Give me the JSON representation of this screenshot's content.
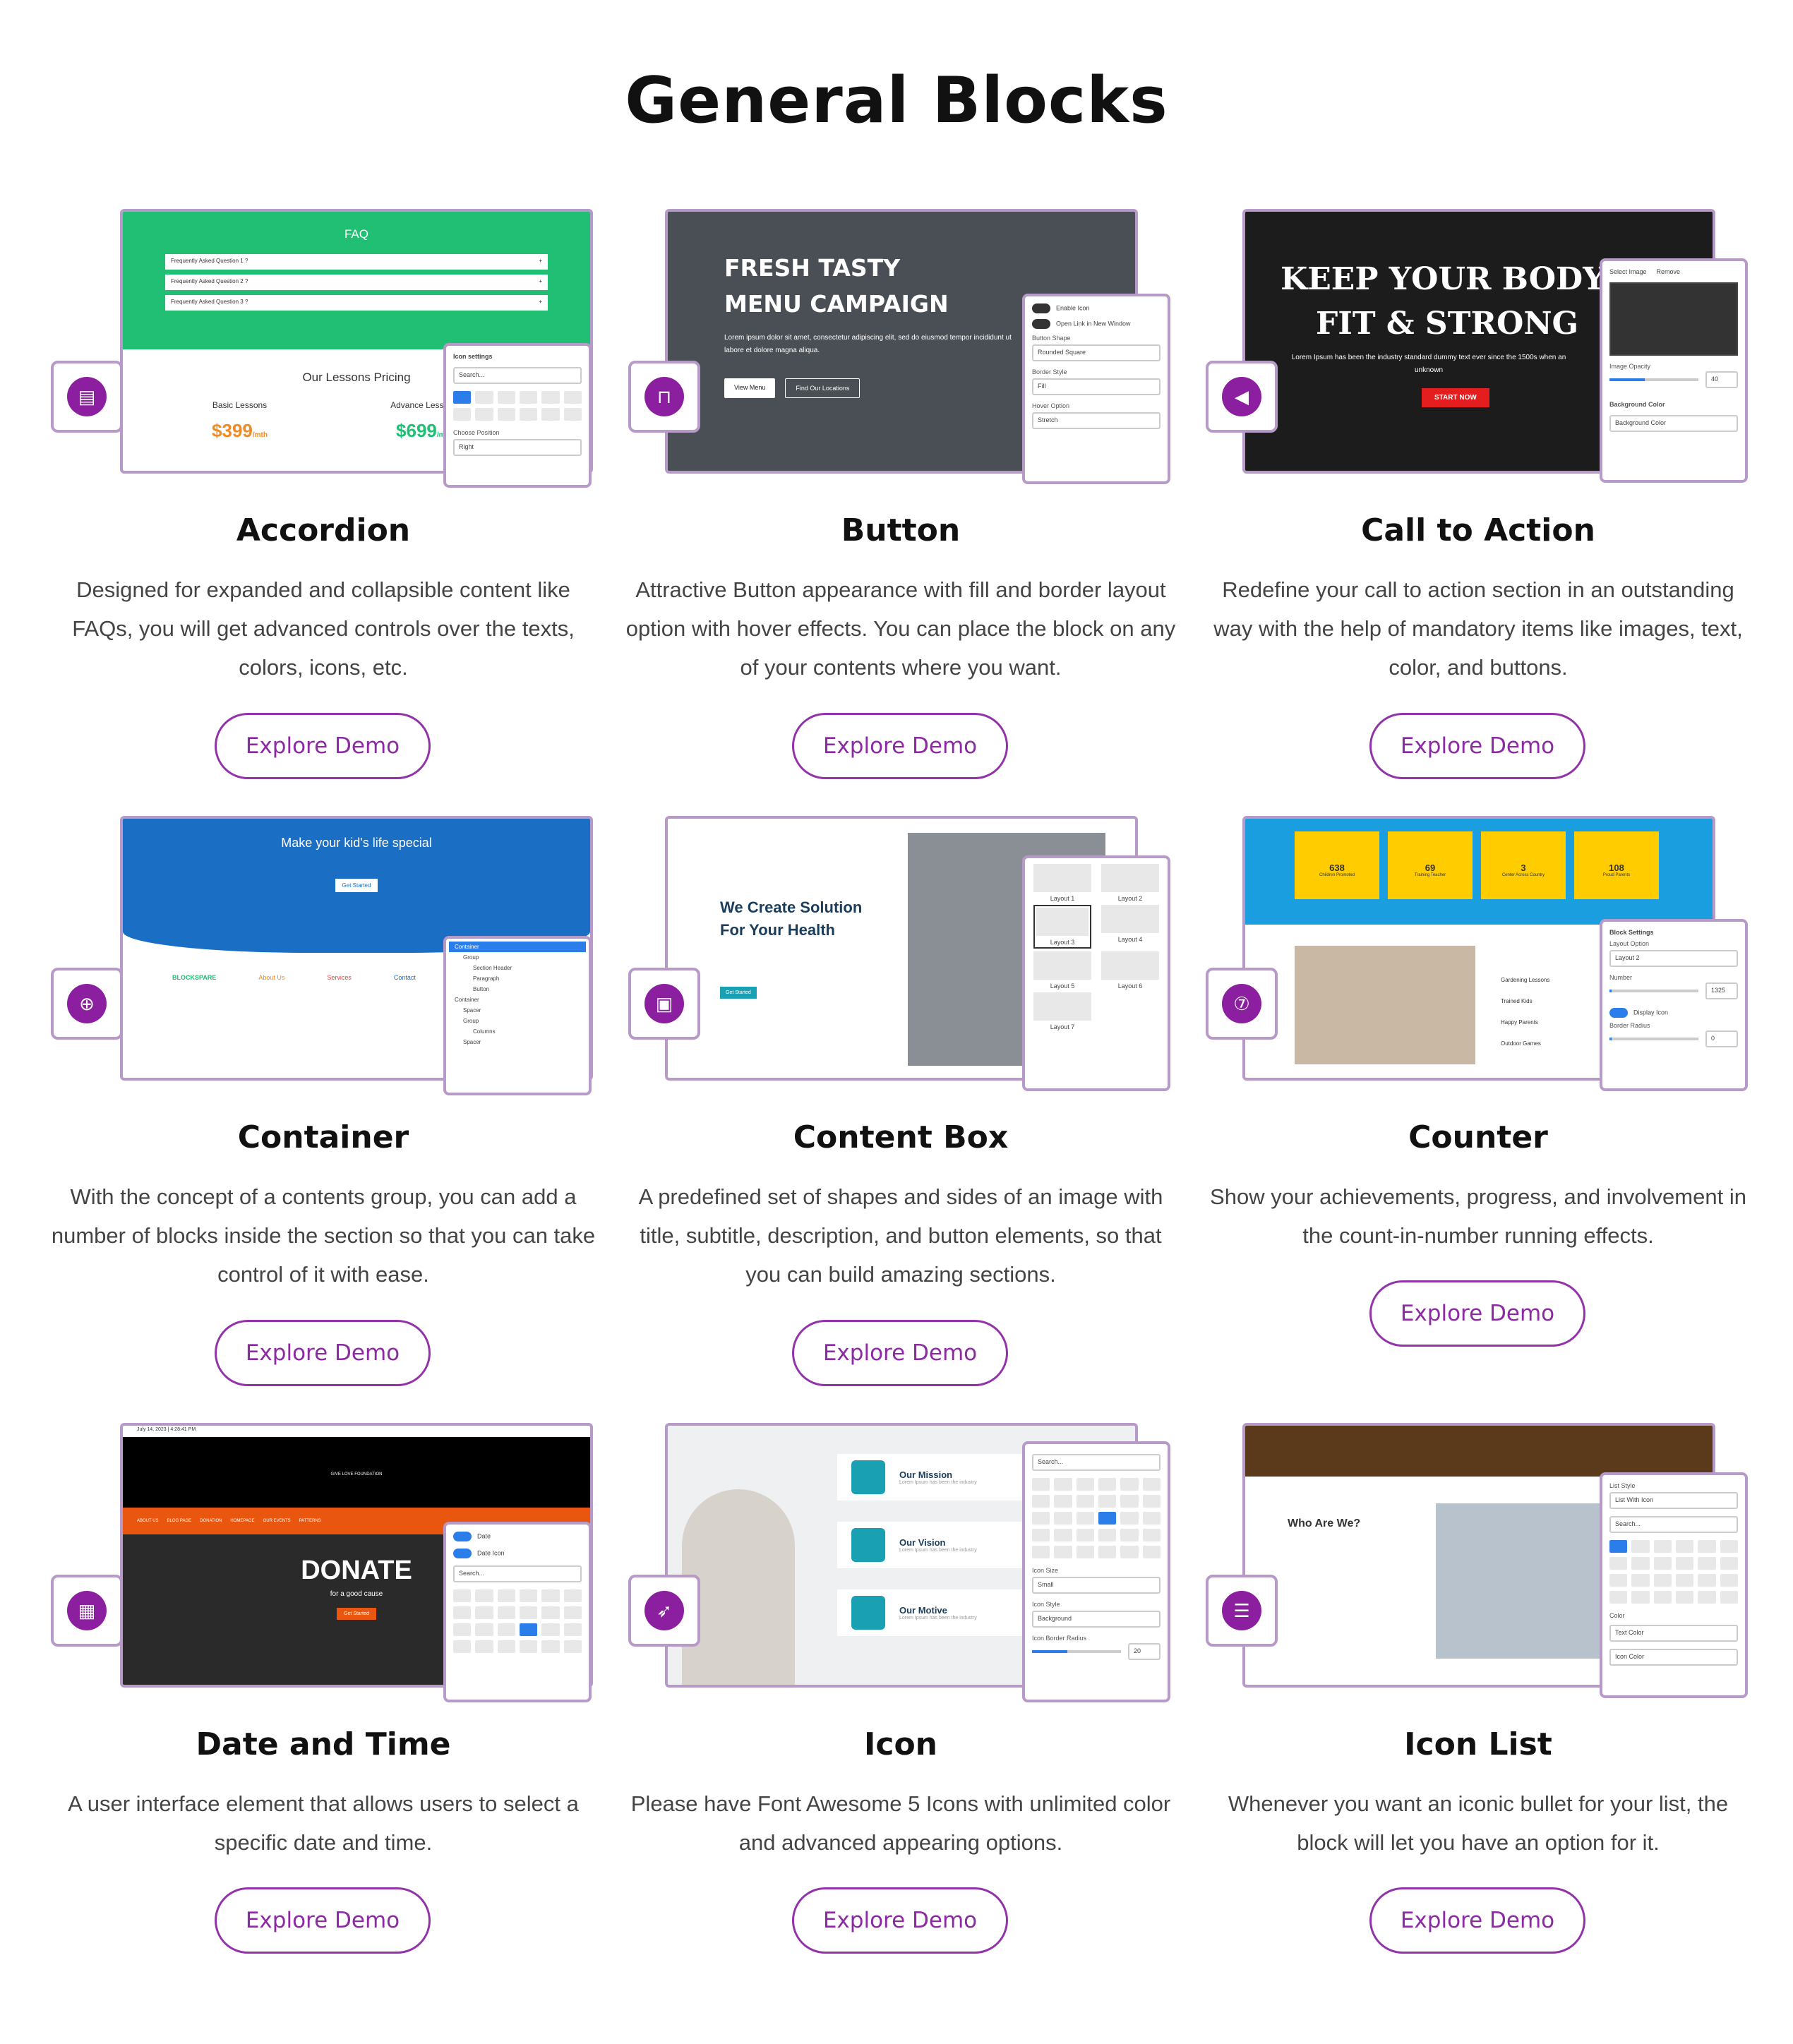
{
  "page": {
    "title": "General Blocks"
  },
  "colors": {
    "accent": "#8c1fa0",
    "border": "#b89ac9",
    "button_text": "#8c2aa3"
  },
  "cards": [
    {
      "title": "Accordion",
      "desc": "Designed for expanded and collapsible content like FAQs, you will get advanced controls over the texts, colors, icons, etc.",
      "button": "Explore Demo",
      "icon": "accordion-icon",
      "preview": {
        "heading": "FAQ",
        "questions": [
          "Frequently Asked Question 1 ?",
          "Frequently Asked Question 2 ?",
          "Frequently Asked Question 3 ?"
        ],
        "pricing_title": "Our Lessons Pricing",
        "plans": [
          {
            "name": "Basic Lessons",
            "price": "399",
            "unit": "/mth"
          },
          {
            "name": "Advance Lessons",
            "price": "699",
            "unit": "/mth"
          }
        ],
        "panel_title": "Icon settings",
        "panel_search": "Search...",
        "panel_pos_label": "Choose Position",
        "panel_pos_value": "Right"
      }
    },
    {
      "title": "Button",
      "desc": "Attractive Button appearance with fill and border layout option with hover effects. You can place the block on any of your contents where you want.",
      "button": "Explore Demo",
      "icon": "button-icon",
      "preview": {
        "line1": "FRESH TASTY",
        "line2": "MENU CAMPAIGN",
        "text": "Lorem ipsum dolor sit amet, consectetur adipiscing elit, sed do eiusmod tempor incididunt ut labore et dolore magna aliqua.",
        "btn1": "View Menu",
        "btn2": "Find Our Locations",
        "opt1": "Enable Icon",
        "opt2": "Open Link in New Window",
        "shape_label": "Button Shape",
        "shape_value": "Rounded Square",
        "border_label": "Border Style",
        "border_value": "Fill",
        "hover_label": "Hover Option",
        "hover_value": "Stretch"
      }
    },
    {
      "title": "Call to Action",
      "desc": "Redefine your call to action section in an outstanding way with the help of mandatory items like images, text, color, and buttons.",
      "button": "Explore Demo",
      "icon": "megaphone-icon",
      "preview": {
        "line1": "KEEP YOUR BODY",
        "line2": "FIT & STRONG",
        "text": "Lorem Ipsum has been the industry standard dummy text ever since the 1500s when an unknown",
        "cta": "START NOW",
        "select_image": "Select Image",
        "remove": "Remove",
        "opacity_label": "Image Opacity",
        "opacity_value": "40",
        "bg_label": "Background Color",
        "bg_item": "Background Color"
      }
    },
    {
      "title": "Container",
      "desc": "With the concept of a contents group, you can add a number of blocks inside the section so that you can take control of it with ease.",
      "button": "Explore Demo",
      "icon": "container-icon",
      "preview": {
        "heading": "Make your kid's life special",
        "cta": "Get Started",
        "brand": "BLOCKSPARE",
        "col1": "About Us",
        "col2": "Services",
        "col3": "Contact",
        "tree": [
          "Container",
          "Group",
          "Section Header",
          "Paragraph",
          "Button",
          "Container",
          "Spacer",
          "Group",
          "Columns",
          "Spacer"
        ]
      }
    },
    {
      "title": "Content Box",
      "desc": "A predefined set of shapes and sides of an image with title, subtitle, description, and button elements, so that you can build amazing sections.",
      "button": "Explore Demo",
      "icon": "content-box-icon",
      "preview": {
        "heading": "We Create Solution For Your Health",
        "cta": "Get Started",
        "layouts": [
          "Layout 1",
          "Layout 2",
          "Layout 3",
          "Layout 4",
          "Layout 5",
          "Layout 6",
          "Layout 7"
        ]
      }
    },
    {
      "title": "Counter",
      "desc": "Show your achievements, progress, and involvement in the count-in-number running effects.",
      "button": "Explore Demo",
      "icon": "counter-icon",
      "preview": {
        "stats": [
          {
            "value": "638",
            "label": "Children Promoted"
          },
          {
            "value": "69",
            "label": "Training Teacher"
          },
          {
            "value": "3",
            "label": "Center Across Country"
          },
          {
            "value": "108",
            "label": "Proud Parents"
          }
        ],
        "bars": [
          "Gardening Lessons",
          "Trained Kids",
          "Happy Parents",
          "Outdoor Games"
        ],
        "panel_title": "Block Settings",
        "layout_label": "Layout Option",
        "layout_value": "Layout 2",
        "number_label": "Number",
        "number_value": "1325",
        "display_icon": "Display Icon",
        "radius_label": "Border Radius",
        "radius_value": "0"
      }
    },
    {
      "title": "Date and Time",
      "desc": "A user interface element that allows users to select a specific date and time.",
      "button": "Explore Demo",
      "icon": "calendar-icon",
      "preview": {
        "topbar": "July 14, 2023 | 4:28:41 PM",
        "logo": "GIVE LOVE FOUNDATION",
        "nav": [
          "ABOUT US",
          "BLOG PAGE",
          "DONATION",
          "HOMEPAGE",
          "OUR EVENTS",
          "PATTERNS"
        ],
        "nav_cta": "Get Started",
        "hero": "DONATE",
        "hero_sub": "for a good cause",
        "hero_cta": "Get Started",
        "opt1": "Date",
        "opt2": "Date Icon",
        "search": "Search..."
      }
    },
    {
      "title": "Icon",
      "desc": "Please have Font Awesome 5 Icons with unlimited color and advanced appearing options.",
      "button": "Explore Demo",
      "icon": "rocket-icon",
      "preview": {
        "items": [
          "Our Mission",
          "Our Vision",
          "Our Motive"
        ],
        "item_text": "Lorem Ipsum has been the industry",
        "search": "Search...",
        "size_label": "Icon Size",
        "size_value": "Small",
        "style_label": "Icon Style",
        "style_value": "Background",
        "radius_label": "Icon Border Radius",
        "radius_value": "20"
      }
    },
    {
      "title": "Icon List",
      "desc": "Whenever you want an iconic bullet for your list, the block will let you have an option for it.",
      "button": "Explore Demo",
      "icon": "list-icon",
      "preview": {
        "heading": "Who Are We?",
        "style_label": "List Style",
        "style_value": "List With Icon",
        "search": "Search...",
        "color_label": "Color",
        "text_color": "Text Color",
        "icon_color": "Icon Color"
      }
    }
  ]
}
